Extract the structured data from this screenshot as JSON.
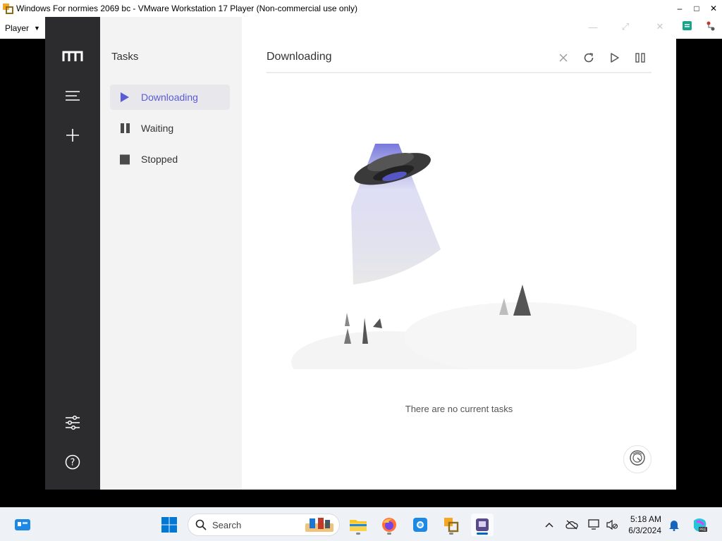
{
  "vm": {
    "title": "Windows For normies 2069 bc - VMware Workstation 17 Player (Non-commercial use only)",
    "menu": {
      "player_label": "Player"
    }
  },
  "app": {
    "panel_title": "Tasks",
    "nav": [
      {
        "label": "Downloading",
        "icon": "play-icon",
        "active": true
      },
      {
        "label": "Waiting",
        "icon": "pause-icon",
        "active": false
      },
      {
        "label": "Stopped",
        "icon": "stop-icon",
        "active": false
      }
    ],
    "main_title": "Downloading",
    "empty_text": "There are no current tasks",
    "accent_color": "#5b5bd6"
  },
  "taskbar": {
    "search_placeholder": "Search",
    "time": "5:18 AM",
    "date": "6/3/2024"
  }
}
